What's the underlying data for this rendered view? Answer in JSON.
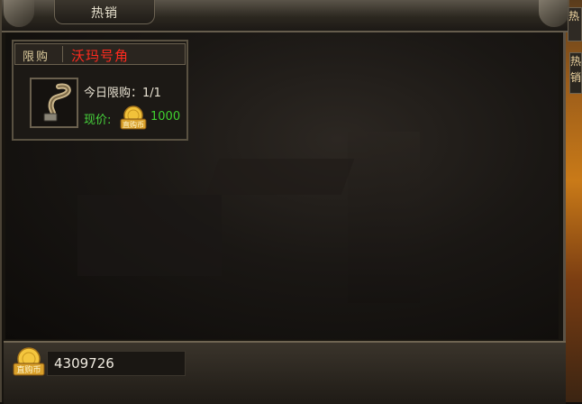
{
  "window": {
    "title": "热销"
  },
  "item_card": {
    "tag": "限购",
    "item_name": "沃玛号角",
    "limit_text": "今日限购：1/1",
    "price_label": "现价:",
    "currency_name": "直购币",
    "price": "1000"
  },
  "balance_bar": {
    "currency_name": "直购币",
    "balance": "4309726"
  },
  "side_panel": {
    "tab1": "热",
    "tab2": "热销"
  },
  "colors": {
    "item_name": "#ff2a1e",
    "price": "#3fd22f",
    "frame": "#595141"
  }
}
